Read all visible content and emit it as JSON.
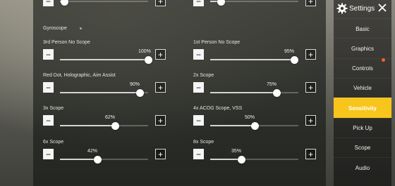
{
  "section": {
    "title": "Gyroscope"
  },
  "sliders": [
    {
      "label": "3rd Person No Scope",
      "value_text": "100%",
      "level": 100
    },
    {
      "label": "1st Person No Scope",
      "value_text": "95%",
      "level": 95
    },
    {
      "label": "Red Dot, Holographic, Aim Assist",
      "value_text": "90%",
      "level": 90
    },
    {
      "label": "2x Scope",
      "value_text": "75%",
      "level": 75
    },
    {
      "label": "3x Scope",
      "value_text": "62%",
      "level": 62
    },
    {
      "label": "4x ACOG Scope, VSS",
      "value_text": "50%",
      "level": 50
    },
    {
      "label": "6x Scope",
      "value_text": "42%",
      "level": 42
    },
    {
      "label": "8x Scope",
      "value_text": "35%",
      "level": 35
    }
  ],
  "top_sliders": [
    {
      "level": 5
    },
    {
      "level": 12
    }
  ],
  "buttons": {
    "minus": "−",
    "plus": "+"
  },
  "sidebar": {
    "title": "Settings",
    "items": [
      "Basic",
      "Graphics",
      "Controls",
      "Vehicle",
      "Sensitivity",
      "Pick Up",
      "Scope",
      "Audio"
    ],
    "active": "Sensitivity",
    "accent": "#f7c51c",
    "notification_color": "#f26522"
  }
}
